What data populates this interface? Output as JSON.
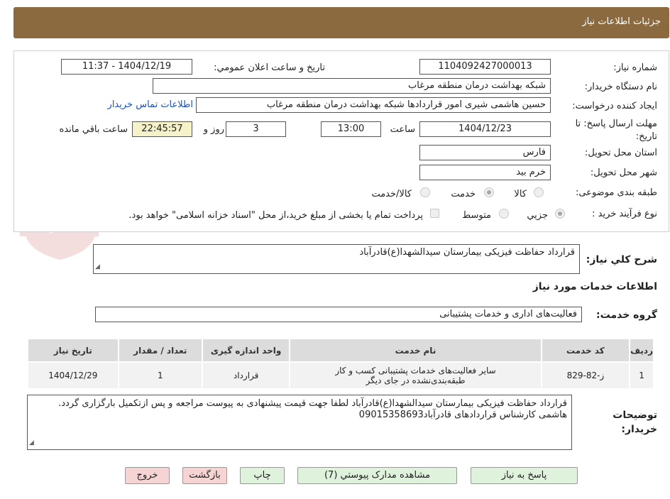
{
  "header": {
    "title": "جزئیات اطلاعات نیاز"
  },
  "fields": {
    "need_number_label": "شماره نیاز:",
    "need_number": "1104092427000013",
    "announce_label": "تاریخ و ساعت اعلان عمومي:",
    "announce_value": "1404/12/19 - 11:37",
    "buyer_org_label": "نام دستگاه خریدار:",
    "buyer_org": "شبکه بهداشت درمان منطقه مرغاب",
    "creator_label": "ایجاد کننده درخواست:",
    "creator": "حسین هاشمی شیری امور قراردادها شبکه بهداشت درمان منطقه مرغاب",
    "contact_link": "اطلاعات تماس خریدار",
    "deadline_label": "مهلت ارسال پاسخ: تا تاریخ:",
    "deadline_date": "1404/12/23",
    "time_label": "ساعت",
    "deadline_time": "13:00",
    "days_value": "3",
    "days_label": "روز و",
    "remaining_time": "22:45:57",
    "remaining_label": "ساعت باقي مانده",
    "province_label": "استان محل تحویل:",
    "province": "فارس",
    "city_label": "شهر محل تحویل:",
    "city": "خرم بید",
    "category_label": "طبقه بندی موضوعی:",
    "category_options": [
      "کالا",
      "خدمت",
      "کالا/خدمت"
    ],
    "category_selected": "خدمت",
    "process_label": "نوع فرآیند خرید :",
    "process_options": [
      "جزيي",
      "متوسط"
    ],
    "process_selected": "جزيي",
    "payment_note": "پرداخت تمام یا بخشی از مبلغ خرید،از محل \"اسناد خزانه اسلامی\" خواهد بود."
  },
  "description": {
    "label": "شرح کلي نیاز:",
    "value": "قرارداد حفاظت فیزیکی بیمارستان سیدالشهدا(ع)قادرآباد"
  },
  "services": {
    "section_title": "اطلاعات خدمات مورد نیاز",
    "group_label": "گروه خدمت:",
    "group_value": "فعالیت‌های اداری و خدمات پشتیبانی"
  },
  "table": {
    "headers": [
      "ردیف",
      "کد خدمت",
      "نام خدمت",
      "واحد اندازه گیری",
      "تعداد / مقدار",
      "تاریخ نیاز"
    ],
    "rows": [
      [
        "1",
        "ز-82-829",
        "سایر فعالیت‌های خدمات پشتیبانی کسب و کار طبقه‌بندی‌نشده در جای دیگر",
        "قرارداد",
        "1",
        "1404/12/29"
      ]
    ]
  },
  "buyer_notes": {
    "label_line1": "توضیحات",
    "label_line2": "خریدار:",
    "line1": "قرارداد حفاظت فیزیکی بیمارستان سیدالشهدا(ع)قادرآباد لطفا جهت قیمت پیشنهادی به پیوست مراجعه و پس ازتکمیل بارگزاری گردد.",
    "line2": "هاشمی کارشناس قراردادهای قادرآباد09015358693"
  },
  "buttons": {
    "reply": "پاسخ به نیاز",
    "attachments": "مشاهده مدارک پیوستي (7)",
    "print": "چاپ",
    "back": "بازگشت",
    "exit": "خروج"
  },
  "colors": {
    "header_bg": "#8b6a3f",
    "link": "#1a4fc4",
    "green_button": "#dff2dc",
    "red_button": "#f7d4d4",
    "timer_bg": "#f5f1c9"
  }
}
